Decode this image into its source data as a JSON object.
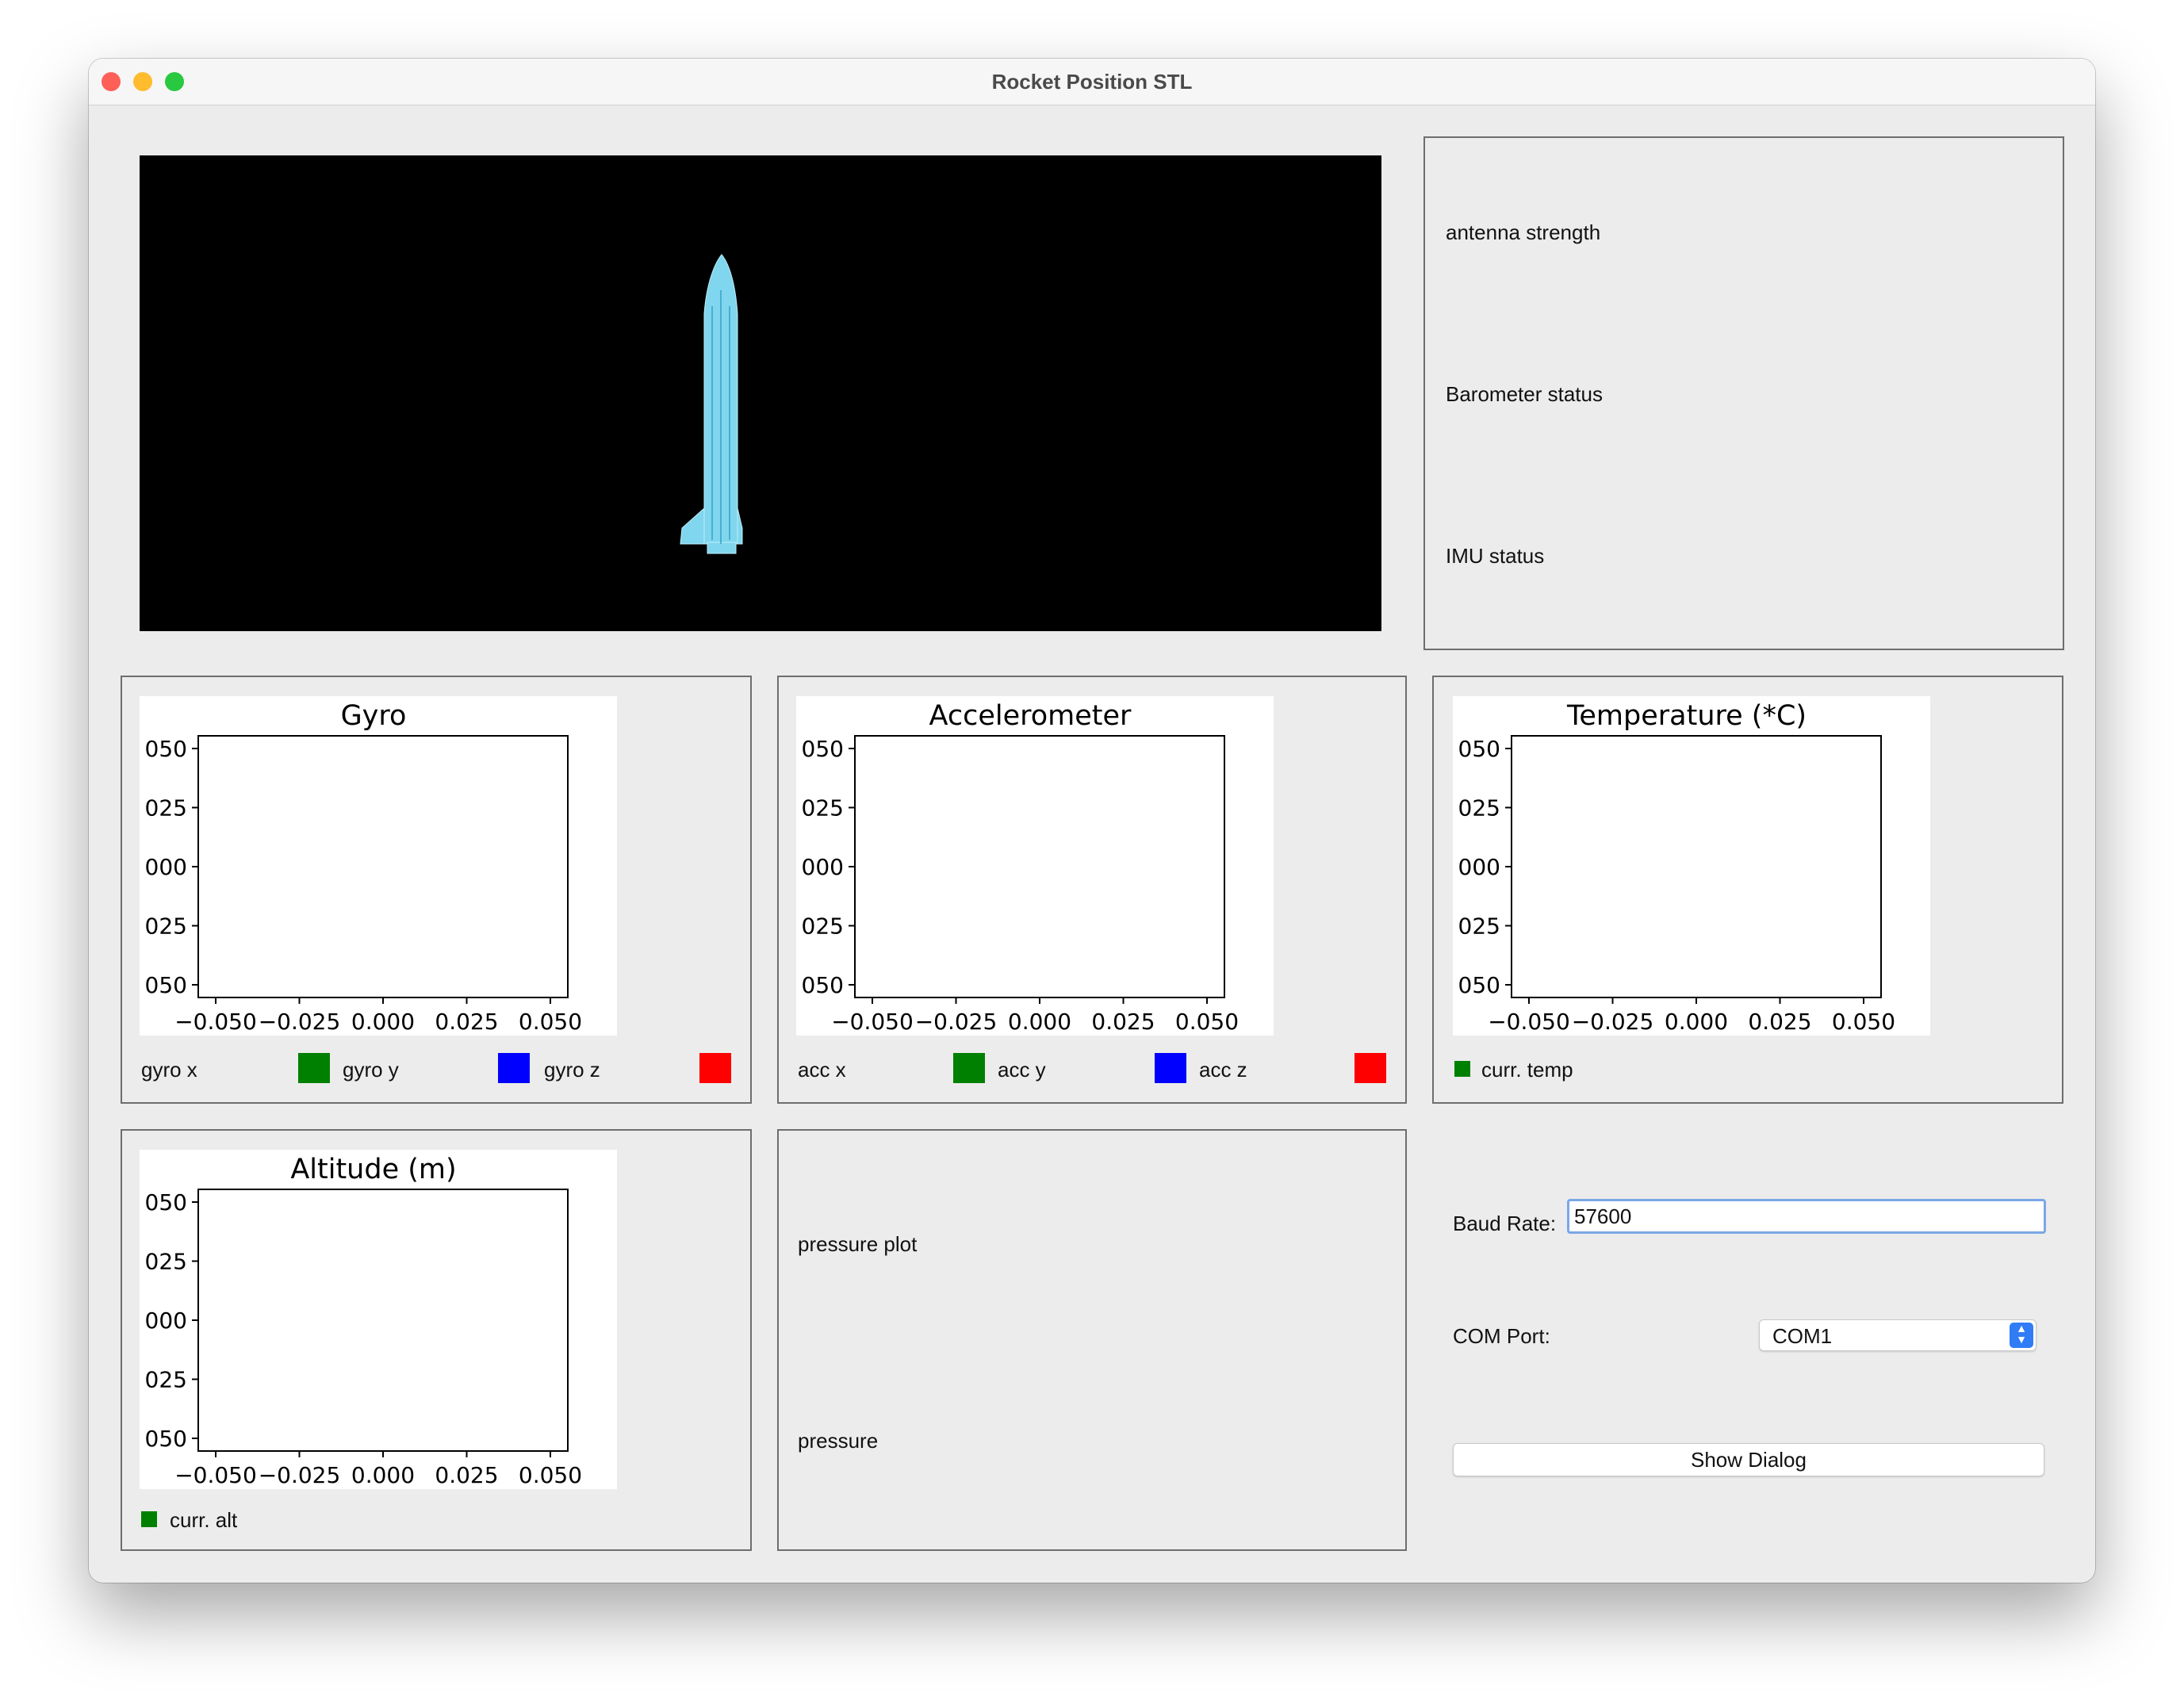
{
  "window": {
    "title": "Rocket Position STL"
  },
  "status_panel": {
    "antenna": "antenna strength",
    "barometer": "Barometer status",
    "imu": "IMU status"
  },
  "charts": {
    "gyro": {
      "title": "Gyro"
    },
    "acc": {
      "title": "Accelerometer"
    },
    "temp": {
      "title": "Temperature (*C)"
    },
    "alt": {
      "title": "Altitude (m)"
    },
    "y_ticks": [
      "050",
      "025",
      "000",
      "025",
      "050"
    ],
    "x_ticks": [
      "−0.050",
      "−0.025",
      "0.000",
      "0.025",
      "0.050"
    ]
  },
  "legends": {
    "gyro": [
      "gyro x",
      "gyro y",
      "gyro z"
    ],
    "acc": [
      "acc x",
      "acc y",
      "acc z"
    ],
    "temp": [
      "curr. temp"
    ],
    "alt": [
      "curr. alt"
    ]
  },
  "pressure": {
    "plot_label": "pressure plot",
    "value_label": "pressure"
  },
  "controls": {
    "baud_label": "Baud Rate:",
    "baud_value": "57600",
    "com_label": "COM Port:",
    "com_value": "COM1",
    "show_dialog": "Show Dialog"
  },
  "colors": {
    "green": "#008000",
    "blue": "#0000ff",
    "red": "#ff0000",
    "rocket": "#7fd6ee",
    "focus": "#7aa7e6"
  },
  "chart_data": [
    {
      "type": "line",
      "title": "Gyro",
      "series": [],
      "xlim": [
        -0.05,
        0.05
      ],
      "ylim": [
        -0.05,
        0.05
      ],
      "x_tick_labels": [
        "−0.050",
        "−0.025",
        "0.000",
        "0.025",
        "0.050"
      ],
      "y_tick_labels": [
        "050",
        "025",
        "000",
        "025",
        "050"
      ]
    },
    {
      "type": "line",
      "title": "Accelerometer",
      "series": [],
      "xlim": [
        -0.05,
        0.05
      ],
      "ylim": [
        -0.05,
        0.05
      ],
      "x_tick_labels": [
        "−0.050",
        "−0.025",
        "0.000",
        "0.025",
        "0.050"
      ],
      "y_tick_labels": [
        "050",
        "025",
        "000",
        "025",
        "050"
      ]
    },
    {
      "type": "line",
      "title": "Temperature (*C)",
      "series": [],
      "xlim": [
        -0.05,
        0.05
      ],
      "ylim": [
        -0.05,
        0.05
      ],
      "x_tick_labels": [
        "−0.050",
        "−0.025",
        "0.000",
        "0.025",
        "0.050"
      ],
      "y_tick_labels": [
        "050",
        "025",
        "000",
        "025",
        "050"
      ]
    },
    {
      "type": "line",
      "title": "Altitude (m)",
      "series": [],
      "xlim": [
        -0.05,
        0.05
      ],
      "ylim": [
        -0.05,
        0.05
      ],
      "x_tick_labels": [
        "−0.050",
        "−0.025",
        "0.000",
        "0.025",
        "0.050"
      ],
      "y_tick_labels": [
        "050",
        "025",
        "000",
        "025",
        "050"
      ]
    }
  ]
}
